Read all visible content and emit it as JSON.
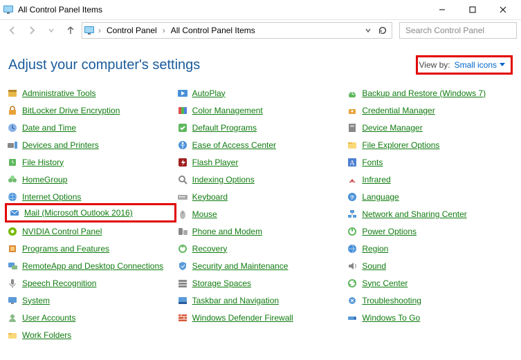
{
  "window": {
    "title": "All Control Panel Items"
  },
  "breadcrumb": {
    "root": "Control Panel",
    "current": "All Control Panel Items"
  },
  "search": {
    "placeholder": "Search Control Panel"
  },
  "header": {
    "title": "Adjust your computer's settings"
  },
  "viewby": {
    "label": "View by:",
    "value": "Small icons"
  },
  "items": [
    {
      "label": "Administrative Tools",
      "icon": "admin",
      "hl": false
    },
    {
      "label": "AutoPlay",
      "icon": "autoplay",
      "hl": false
    },
    {
      "label": "Backup and Restore (Windows 7)",
      "icon": "backup",
      "hl": false
    },
    {
      "label": "BitLocker Drive Encryption",
      "icon": "bitlocker",
      "hl": false
    },
    {
      "label": "Color Management",
      "icon": "color",
      "hl": false
    },
    {
      "label": "Credential Manager",
      "icon": "credential",
      "hl": false
    },
    {
      "label": "Date and Time",
      "icon": "datetime",
      "hl": false
    },
    {
      "label": "Default Programs",
      "icon": "defaults",
      "hl": false
    },
    {
      "label": "Device Manager",
      "icon": "devicemgr",
      "hl": false
    },
    {
      "label": "Devices and Printers",
      "icon": "devices",
      "hl": false
    },
    {
      "label": "Ease of Access Center",
      "icon": "ease",
      "hl": false
    },
    {
      "label": "File Explorer Options",
      "icon": "explorer",
      "hl": false
    },
    {
      "label": "File History",
      "icon": "filehistory",
      "hl": false
    },
    {
      "label": "Flash Player",
      "icon": "flash",
      "hl": false
    },
    {
      "label": "Fonts",
      "icon": "fonts",
      "hl": false
    },
    {
      "label": "HomeGroup",
      "icon": "homegroup",
      "hl": false
    },
    {
      "label": "Indexing Options",
      "icon": "indexing",
      "hl": false
    },
    {
      "label": "Infrared",
      "icon": "infrared",
      "hl": false
    },
    {
      "label": "Internet Options",
      "icon": "internet",
      "hl": false
    },
    {
      "label": "Keyboard",
      "icon": "keyboard",
      "hl": false
    },
    {
      "label": "Language",
      "icon": "language",
      "hl": false
    },
    {
      "label": "Mail (Microsoft Outlook 2016)",
      "icon": "mail",
      "hl": true
    },
    {
      "label": "Mouse",
      "icon": "mouse",
      "hl": false
    },
    {
      "label": "Network and Sharing Center",
      "icon": "network",
      "hl": false
    },
    {
      "label": "NVIDIA Control Panel",
      "icon": "nvidia",
      "hl": false
    },
    {
      "label": "Phone and Modem",
      "icon": "phone",
      "hl": false
    },
    {
      "label": "Power Options",
      "icon": "power",
      "hl": false
    },
    {
      "label": "Programs and Features",
      "icon": "programs",
      "hl": false
    },
    {
      "label": "Recovery",
      "icon": "recovery",
      "hl": false
    },
    {
      "label": "Region",
      "icon": "region",
      "hl": false
    },
    {
      "label": "RemoteApp and Desktop Connections",
      "icon": "remote",
      "hl": false
    },
    {
      "label": "Security and Maintenance",
      "icon": "security",
      "hl": false
    },
    {
      "label": "Sound",
      "icon": "sound",
      "hl": false
    },
    {
      "label": "Speech Recognition",
      "icon": "speech",
      "hl": false
    },
    {
      "label": "Storage Spaces",
      "icon": "storage",
      "hl": false
    },
    {
      "label": "Sync Center",
      "icon": "sync",
      "hl": false
    },
    {
      "label": "System",
      "icon": "system",
      "hl": false
    },
    {
      "label": "Taskbar and Navigation",
      "icon": "taskbar",
      "hl": false
    },
    {
      "label": "Troubleshooting",
      "icon": "troubleshoot",
      "hl": false
    },
    {
      "label": "User Accounts",
      "icon": "users",
      "hl": false
    },
    {
      "label": "Windows Defender Firewall",
      "icon": "firewall",
      "hl": false
    },
    {
      "label": "Windows To Go",
      "icon": "wintogo",
      "hl": false
    },
    {
      "label": "Work Folders",
      "icon": "workfolders",
      "hl": false
    }
  ]
}
